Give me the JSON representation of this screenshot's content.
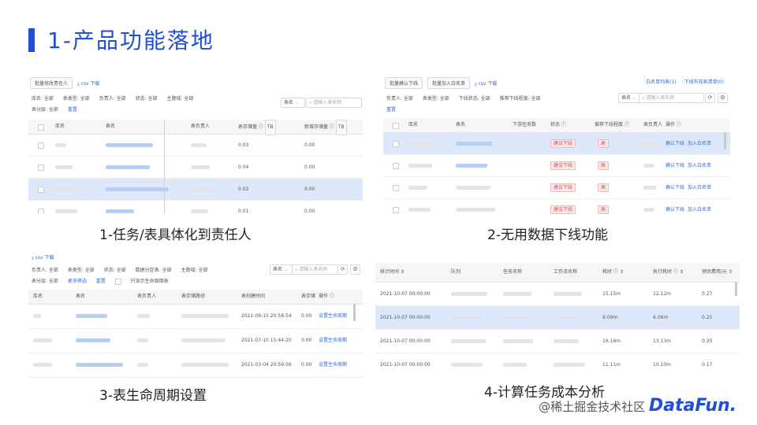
{
  "slide": {
    "title": "1-产品功能落地"
  },
  "captions": [
    "1-任务/表具体化到责任人",
    "2-无用数据下线功能",
    "3-表生命周期设置",
    "4-计算任务成本分析"
  ],
  "panel1": {
    "toolbar": {
      "btn_batch": "批量修改责任人",
      "csv": "csv 下载"
    },
    "filters": [
      "库名: 全部",
      "表类型: 全部",
      "负责人: 全部",
      "状态: 全部",
      "主题域: 全部",
      "表分层: 全部",
      "重置"
    ],
    "search": {
      "select": "表名",
      "placeholder": "请输入表名称"
    },
    "headers": [
      "库名",
      "表名",
      "表负责人",
      "表存储量 ⓘ",
      "新增存储量 ⓘ"
    ],
    "unit": "TB",
    "rows": [
      {
        "col3": "0.03",
        "col4": "0.00"
      },
      {
        "col3": "0.04",
        "col4": "0.00"
      },
      {
        "col3": "0.02",
        "col4": "0.00"
      },
      {
        "col3": "0.01",
        "col4": "0.00"
      }
    ]
  },
  "panel2": {
    "toolbar": {
      "btn1": "批量确认下线",
      "btn2": "批量加入白名单",
      "csv": "csv 下载",
      "link1": "白名单列表(1)",
      "link2": "下线失效表清单(0)"
    },
    "filters": [
      "负责人: 全部",
      "表类型: 全部",
      "下线状态: 全部",
      "推荐下线程度: 全部",
      "重置"
    ],
    "search": {
      "select": "表名",
      "placeholder": "请输入表名称"
    },
    "headers": [
      "库名",
      "表名",
      "下游任务数",
      "状态 ⓘ",
      "推荐下线程度 ⓘ",
      "表负责人",
      "操作 ⓘ"
    ],
    "rows": [
      {
        "status": "建议下线",
        "level": "高",
        "op1": "确认下线",
        "op2": "加入白名单"
      },
      {
        "status": "建议下线",
        "level": "高",
        "op1": "确认下线",
        "op2": "加入白名单"
      },
      {
        "status": "建议下线",
        "level": "高",
        "op1": "确认下线",
        "op2": "加入白名单"
      },
      {
        "status": "建议下线",
        "level": "高",
        "op1": "确认下线",
        "op2": "加入白名单"
      }
    ]
  },
  "panel3": {
    "toolbar": {
      "csv": "csv 下载"
    },
    "filters": [
      "负责人: 全部",
      "表类型: 全部",
      "状态: 全部",
      "数据分区表: 全部",
      "主题域: 全部",
      "表分层: 全部",
      "更多筛选",
      "重置",
      "只显示生命周期表"
    ],
    "search": {
      "select": "表名",
      "placeholder": "请输入表名称"
    },
    "headers": [
      "库名",
      "表名",
      "表负责人",
      "表存储路径",
      "表创建时间",
      "表存储",
      "操作 ⓘ"
    ],
    "rows": [
      {
        "time": "2021-09-15 20:58:54",
        "size": "0.00",
        "op": "设置生命周期"
      },
      {
        "time": "2021-07-10 15:44:20",
        "size": "0.00",
        "op": "设置生命周期"
      },
      {
        "time": "2021-03-04 20:59:56",
        "size": "0.00",
        "op": "设置生命周期"
      }
    ]
  },
  "panel4": {
    "headers": [
      "统计时间 ⇕",
      "队列",
      "任务名称",
      "工作流名称",
      "耗时 ⓘ ⇕",
      "执行耗时 ⓘ ⇕",
      "预估费用/元 ⇕"
    ],
    "rows": [
      {
        "time": "2021-10-07 00:00:00",
        "dur": "15.15m",
        "exec": "12.12m",
        "cost": "0.27"
      },
      {
        "time": "2021-10-07 00:00:00",
        "dur": "9.09m",
        "exec": "6.06m",
        "cost": "0.25"
      },
      {
        "time": "2021-10-07 00:00:00",
        "dur": "16.16m",
        "exec": "13.13m",
        "cost": "0.20"
      },
      {
        "time": "2021-10-07 00:00:00",
        "dur": "11.11m",
        "exec": "10.10m",
        "cost": "0.17"
      }
    ]
  },
  "watermark": {
    "text": "@稀土掘金技术社区",
    "brand": "DataFun."
  }
}
